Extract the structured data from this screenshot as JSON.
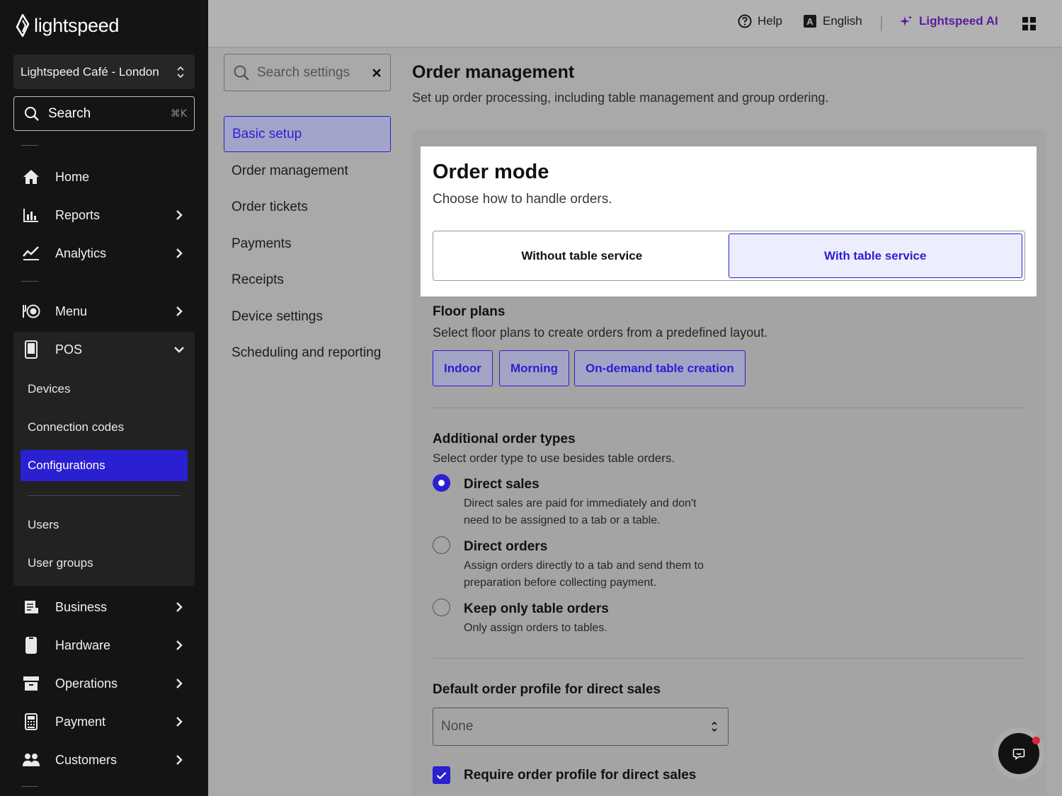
{
  "brand": {
    "logo_text": "lightspeed"
  },
  "sidebar": {
    "store": "Lightspeed Café - London",
    "search": {
      "label": "Search",
      "shortcut": "⌘K"
    },
    "nav": {
      "home": "Home",
      "reports": "Reports",
      "analytics": "Analytics",
      "menu": "Menu",
      "pos": "POS",
      "business": "Business",
      "hardware": "Hardware",
      "operations": "Operations",
      "payment": "Payment",
      "customers": "Customers"
    },
    "pos_items": [
      "Devices",
      "Connection codes",
      "Configurations",
      "Users",
      "User groups"
    ],
    "active_item": "Configurations"
  },
  "topbar": {
    "help": "Help",
    "language": "English",
    "ai": "Lightspeed AI"
  },
  "settings_nav": {
    "search_placeholder": "Search settings",
    "items": [
      "Basic setup",
      "Order management",
      "Order tickets",
      "Payments",
      "Receipts",
      "Device settings",
      "Scheduling and reporting"
    ],
    "active": "Basic setup"
  },
  "page": {
    "title": "Order management",
    "subtitle": "Set up order processing, including table management and group ordering."
  },
  "order_mode": {
    "title": "Order mode",
    "subtitle": "Choose how to handle orders.",
    "options": [
      "Without table service",
      "With table service"
    ],
    "selected": "With table service"
  },
  "floor_plans": {
    "title": "Floor plans",
    "subtitle": "Select floor plans to create orders from a predefined layout.",
    "chips": [
      "Indoor",
      "Morning",
      "On-demand table creation"
    ]
  },
  "additional_order_types": {
    "title": "Additional order types",
    "subtitle": "Select order type to use besides table orders.",
    "options": [
      {
        "title": "Direct sales",
        "desc_line1": "Direct sales are paid for immediately and don't",
        "desc_line2": "need to be assigned to a tab or a table.",
        "selected": true
      },
      {
        "title": "Direct orders",
        "desc_line1": "Assign orders directly to a tab and send them to",
        "desc_line2": "preparation before collecting payment.",
        "selected": false
      },
      {
        "title": "Keep only table orders",
        "desc_line1": "Only assign orders to tables.",
        "desc_line2": "",
        "selected": false
      }
    ]
  },
  "default_profile": {
    "title": "Default order profile for direct sales",
    "value": "None",
    "require_label": "Require order profile for direct sales",
    "require_checked": true
  },
  "colors": {
    "accent": "#2A1FD1",
    "ai": "#5B1A9E",
    "notification": "#E0223B"
  }
}
